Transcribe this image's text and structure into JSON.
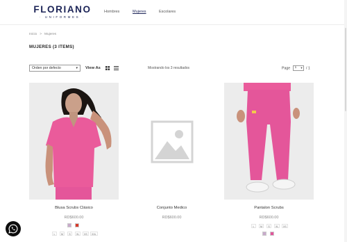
{
  "brand": {
    "name": "FLORIANO",
    "tagline": "· UNIFORMES ·",
    "color": "#1c2457"
  },
  "nav": {
    "items": [
      "Hombres",
      "Mujeres",
      "Escolares"
    ],
    "active": "Mujeres"
  },
  "breadcrumb": {
    "home": "Inicio",
    "separator": ">",
    "current": "Mujeres"
  },
  "page": {
    "title": "MUJERES (3 ITEMS)"
  },
  "toolbar": {
    "sort_value": "Orden por defecto",
    "view_as_label": "View As",
    "results_text": "Mostrando los 3 resultados",
    "page_label": "Page",
    "page_current": "1",
    "page_total": "/ 1"
  },
  "products": [
    {
      "name": "Blusa Scrubs Clásico",
      "price": "RD$600.00",
      "swatches": [
        "#c8aacb",
        "#d83a2a"
      ],
      "sizes": [
        "L",
        "M",
        "S",
        "XL",
        "XS",
        "XXL"
      ]
    },
    {
      "name": "Conjunto Medico",
      "price": "RD$600.00",
      "swatches": [],
      "sizes": []
    },
    {
      "name": "Pantalon Scrubs",
      "price": "RD$600.00",
      "swatches": [
        "#c8aacb",
        "#e0559a"
      ],
      "sizes": [
        "L",
        "M",
        "S",
        "XL",
        "XS"
      ]
    }
  ],
  "accent_pink": "#ea5b9b",
  "chat_icon": "whatsapp-icon"
}
